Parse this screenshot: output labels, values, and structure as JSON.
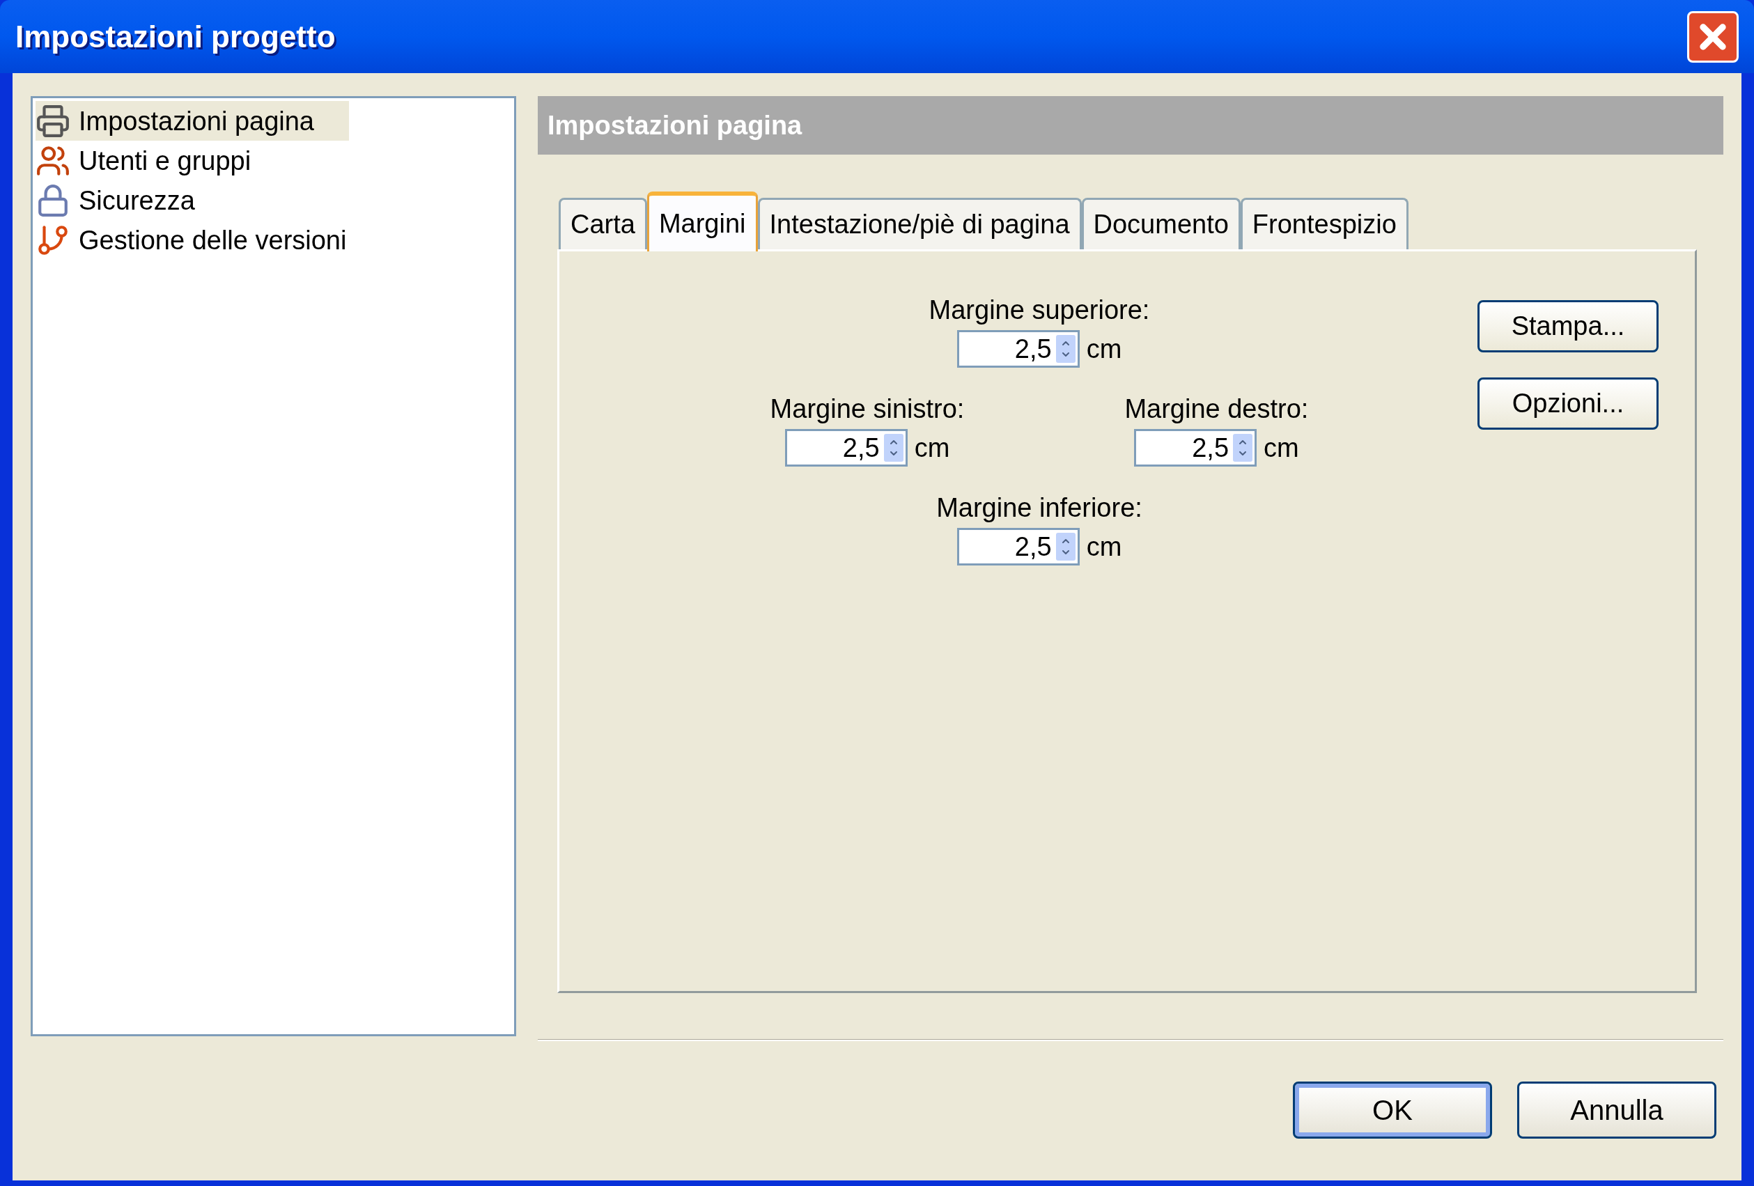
{
  "window": {
    "title": "Impostazioni progetto"
  },
  "sidebar": {
    "items": [
      {
        "label": "Impostazioni pagina",
        "kind": "printer",
        "selected": true
      },
      {
        "label": "Utenti e gruppi",
        "kind": "users",
        "selected": false
      },
      {
        "label": "Sicurezza",
        "kind": "lock",
        "selected": false
      },
      {
        "label": "Gestione delle versioni",
        "kind": "versions",
        "selected": false
      }
    ]
  },
  "header": {
    "title": "Impostazioni pagina"
  },
  "tabs": [
    {
      "label": "Carta",
      "selected": false
    },
    {
      "label": "Margini",
      "selected": true
    },
    {
      "label": "Intestazione/piè di pagina",
      "selected": false
    },
    {
      "label": "Documento",
      "selected": false
    },
    {
      "label": "Frontespizio",
      "selected": false
    }
  ],
  "margins": {
    "top": {
      "label": "Margine superiore:",
      "value": "2,5",
      "unit": "cm"
    },
    "left": {
      "label": "Margine sinistro:",
      "value": "2,5",
      "unit": "cm"
    },
    "right": {
      "label": "Margine destro:",
      "value": "2,5",
      "unit": "cm"
    },
    "bottom": {
      "label": "Margine inferiore:",
      "value": "2,5",
      "unit": "cm"
    }
  },
  "side_buttons": [
    "Stampa...",
    "Opzioni..."
  ],
  "footer_buttons": [
    {
      "label": "OK",
      "default": true
    },
    {
      "label": "Annulla",
      "default": false
    }
  ]
}
